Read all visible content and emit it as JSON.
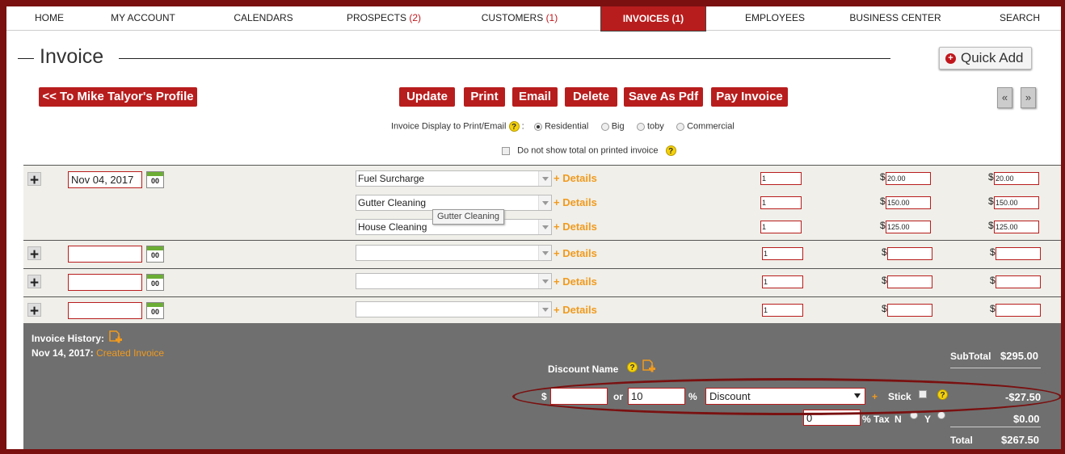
{
  "nav": {
    "items": [
      {
        "label": "HOME",
        "count": ""
      },
      {
        "label": "MY ACCOUNT",
        "count": ""
      },
      {
        "label": "CALENDARS",
        "count": ""
      },
      {
        "label": "PROSPECTS ",
        "count": "(2)"
      },
      {
        "label": "CUSTOMERS ",
        "count": "(1)"
      },
      {
        "label": "EMPLOYEES",
        "count": ""
      },
      {
        "label": "BUSINESS CENTER",
        "count": ""
      },
      {
        "label": "SEARCH",
        "count": ""
      }
    ],
    "active": "INVOICES (1)"
  },
  "page": {
    "title": "Invoice",
    "quick_add": "Quick Add",
    "profile_button": "<< To Mike Talyor's Profile"
  },
  "actions": {
    "update": "Update",
    "print": "Print",
    "email": "Email",
    "delete": "Delete",
    "save_pdf": "Save As Pdf",
    "pay": "Pay Invoice",
    "prev": "«",
    "next": "»"
  },
  "display": {
    "label": "Invoice Display to Print/Email",
    "colon": ":",
    "options": [
      "Residential",
      "Big",
      "toby",
      "Commercial"
    ],
    "selected": "Residential",
    "no_total_label": "Do not show total on printed invoice"
  },
  "rows": [
    {
      "date": "Nov 04, 2017",
      "items": [
        {
          "service": "Fuel Surcharge",
          "details": "+ Details",
          "qty": "1",
          "price": "20.00",
          "total": "20.00"
        },
        {
          "service": "Gutter Cleaning",
          "details": "+ Details",
          "qty": "1",
          "price": "150.00",
          "total": "150.00"
        },
        {
          "service": "House Cleaning",
          "details": "+ Details",
          "qty": "1",
          "price": "125.00",
          "total": "125.00"
        }
      ]
    },
    {
      "date": "",
      "items": [
        {
          "service": "",
          "details": "+ Details",
          "qty": "1",
          "price": "",
          "total": ""
        }
      ]
    },
    {
      "date": "",
      "items": [
        {
          "service": "",
          "details": "+ Details",
          "qty": "1",
          "price": "",
          "total": ""
        }
      ]
    },
    {
      "date": "",
      "items": [
        {
          "service": "",
          "details": "+ Details",
          "qty": "1",
          "price": "",
          "total": ""
        }
      ]
    }
  ],
  "calendar_icon_text": "00",
  "currency": "$",
  "tooltip": "Gutter Cleaning",
  "history": {
    "label": "Invoice History:",
    "date": "Nov 14, 2017:",
    "event": "Created Invoice"
  },
  "discount": {
    "name_label": "Discount Name",
    "amount_value": "",
    "or": "or",
    "percent_value": "10",
    "percent_sign": "%",
    "type": "Discount",
    "plus": "+",
    "stick": "Stick",
    "tax_value": "0",
    "tax_label": "% Tax",
    "tax_n": "N",
    "tax_y": "Y"
  },
  "totals": {
    "subtotal_label": "SubTotal",
    "subtotal": "$295.00",
    "discount": "-$27.50",
    "tax": "$0.00",
    "total_label": "Total",
    "total": "$267.50"
  },
  "colors": {
    "brand": "#b81d1d",
    "accent": "#f19a1d",
    "footer": "#6f6f6f",
    "frame": "#7a1010"
  }
}
